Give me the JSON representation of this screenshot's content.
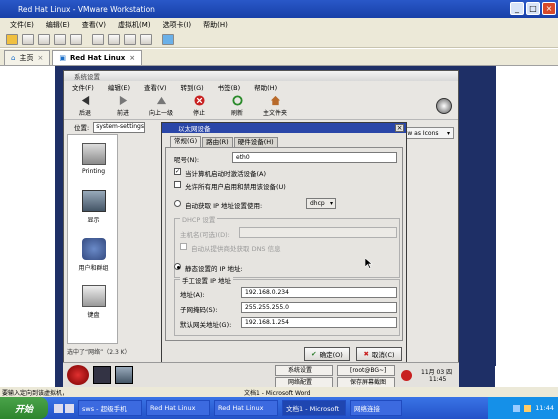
{
  "vm": {
    "title": "Red Hat Linux - VMware Workstation",
    "menu": [
      "文件(E)",
      "编辑(E)",
      "查看(V)",
      "虚拟机(M)",
      "选项卡(I)",
      "帮助(H)"
    ],
    "tabs": [
      {
        "label": "主页"
      },
      {
        "label": "Red Hat Linux"
      }
    ],
    "status_hint": "要输入定向到该虚拟机，"
  },
  "gnome": {
    "title": "系统设置",
    "menu": [
      "文件(F)",
      "编辑(E)",
      "查看(V)",
      "转到(G)",
      "书签(B)",
      "帮助(H)"
    ],
    "toolbar": [
      "后退",
      "前进",
      "向上一级",
      "停止",
      "刷新",
      "主文件夹"
    ],
    "location_label": "位置:",
    "location_value": "system-settings:///",
    "view_as": "View as Icons",
    "sidebar": [
      {
        "label": "Printing"
      },
      {
        "label": "显示"
      },
      {
        "label": "用户和群组"
      },
      {
        "label": "键盘"
      }
    ],
    "status": "选中了“网络”（2.3 K）"
  },
  "dialog": {
    "title": "以太网设备",
    "tabs": [
      "常规(G)",
      "路由(R)",
      "硬件设备(H)"
    ],
    "nickname_label": "呢号(N):",
    "nickname_value": "eth0",
    "cb_boot": "当计算机启动时激活设备(A)",
    "cb_users": "允许所有用户启用和禁用该设备(U)",
    "radio_auto": "自动获取 IP 地址设置使用:",
    "auto_method": "dhcp",
    "dhcp_group": "DHCP 设置",
    "hostname_label": "主机名(可选)(D):",
    "cb_dns": "自动从提供商处获取 DNS 信息",
    "radio_static": "静态设置的 IP 地址:",
    "static_group": "手工设置 IP 地址",
    "addr_label": "地址(A):",
    "addr_value": "192.168.0.234",
    "mask_label": "子网掩码(S):",
    "mask_value": "255.255.255.0",
    "gw_label": "默认网关地址(G):",
    "gw_value": "192.168.1.254",
    "ok_label": "确定(O)",
    "cancel_label": "取消(C)"
  },
  "panel": {
    "btn1": "系统设置",
    "btn2": "[root@BG~]",
    "btn3": "网络配置",
    "btn4": "保存屏幕截图",
    "clock_date": "11月 03 四",
    "clock_time": "11:45"
  },
  "taskbar": {
    "start": "开始",
    "tasks": [
      "sws - 超级手机",
      "Red Hat Linux",
      "Red Hat Linux",
      "文档1 - Microsoft",
      "网络连接"
    ],
    "clock": "11:44"
  },
  "word_title": "文档1 - Microsoft Word"
}
